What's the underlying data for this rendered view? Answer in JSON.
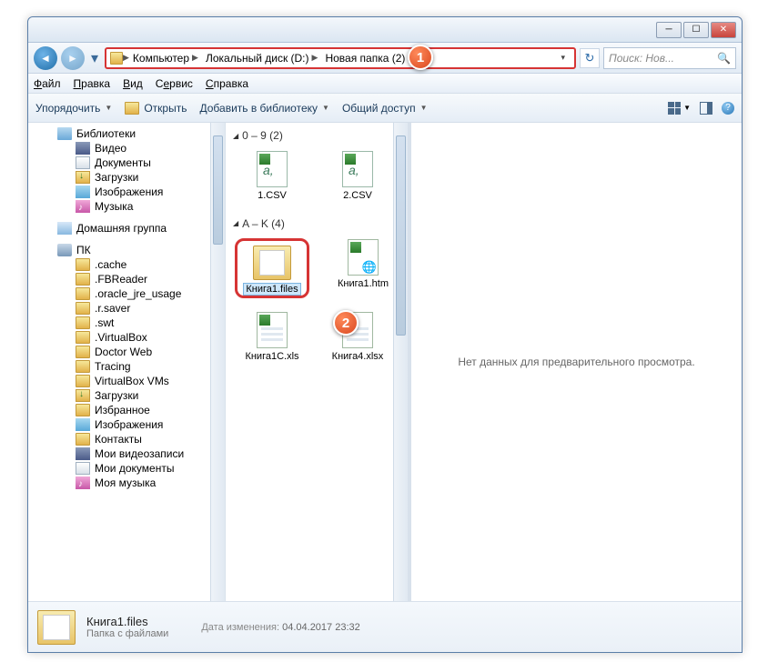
{
  "titlebar": {
    "min": "─",
    "max": "☐",
    "close": "✕"
  },
  "nav": {
    "back": "◄",
    "fwd": "►",
    "drop": "▾",
    "crumbs": [
      "Компьютер",
      "Локальный диск (D:)",
      "Новая папка (2)"
    ],
    "refresh": "↻",
    "search_placeholder": "Поиск: Нов...",
    "search_icon": "🔍"
  },
  "menubar": {
    "items": [
      "Файл",
      "Правка",
      "Вид",
      "Сервис",
      "Справка"
    ]
  },
  "toolbar": {
    "organize": "Упорядочить",
    "open": "Открыть",
    "addlib": "Добавить в библиотеку",
    "share": "Общий доступ",
    "help": "?"
  },
  "sidebar": {
    "libraries": "Библиотеки",
    "lib_items": [
      "Видео",
      "Документы",
      "Загрузки",
      "Изображения",
      "Музыка"
    ],
    "homegroup": "Домашняя группа",
    "pc": "ПК",
    "pc_items": [
      ".cache",
      ".FBReader",
      ".oracle_jre_usage",
      ".r.saver",
      ".swt",
      ".VirtualBox",
      "Doctor Web",
      "Tracing",
      "VirtualBox VMs",
      "Загрузки",
      "Избранное",
      "Изображения",
      "Контакты",
      "Мои видеозаписи",
      "Мои документы",
      "Моя музыка"
    ]
  },
  "groups": {
    "g1": "0 – 9 (2)",
    "g2": "A – K (4)"
  },
  "files": {
    "csv1": "1.CSV",
    "csv2": "2.CSV",
    "kfiles": "Книга1.files",
    "khtm": "Книга1.htm",
    "kxls": "Книга1C.xls",
    "kxlsx": "Книга4.xlsx"
  },
  "preview": "Нет данных для предварительного просмотра.",
  "status": {
    "name": "Книга1.files",
    "type": "Папка с файлами",
    "date_label": "Дата изменения:",
    "date": "04.04.2017 23:32"
  },
  "callouts": {
    "c1": "1",
    "c2": "2"
  }
}
